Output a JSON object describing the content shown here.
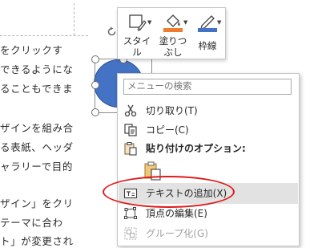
{
  "document": {
    "lines": [
      "をクリックす",
      "できるようにな",
      "ることもできま",
      "ザインを組み合",
      "る表紙、ヘッダ",
      "ャラリーで目的",
      "ザイン」をクリ",
      "テーマに合わ",
      "ト」が変更され"
    ]
  },
  "mini_toolbar": {
    "style_label_1": "スタイ",
    "style_label_2": "ル",
    "fill_label_1": "塗りつ",
    "fill_label_2": "ぶし",
    "outline_label": "枠線",
    "fill_color": "#ed7d31",
    "outline_color": "#4472c4"
  },
  "context_menu": {
    "search_placeholder": "メニューの検索",
    "items": [
      {
        "label": "切り取り(T)",
        "icon": "scissors-icon"
      },
      {
        "label": "コピー(C)",
        "icon": "copy-icon"
      },
      {
        "label": "貼り付けのオプション:",
        "icon": "paste-icon"
      },
      {
        "label": "テキストの追加(X)",
        "icon": "add-text-icon"
      },
      {
        "label": "頂点の編集(E)",
        "icon": "edit-points-icon"
      },
      {
        "label": "グループ化(G)",
        "icon": "group-icon"
      }
    ]
  },
  "colors": {
    "shape_fill": "#4472c4",
    "highlight": "#e2e2e2",
    "annotation": "#e01a1a"
  }
}
